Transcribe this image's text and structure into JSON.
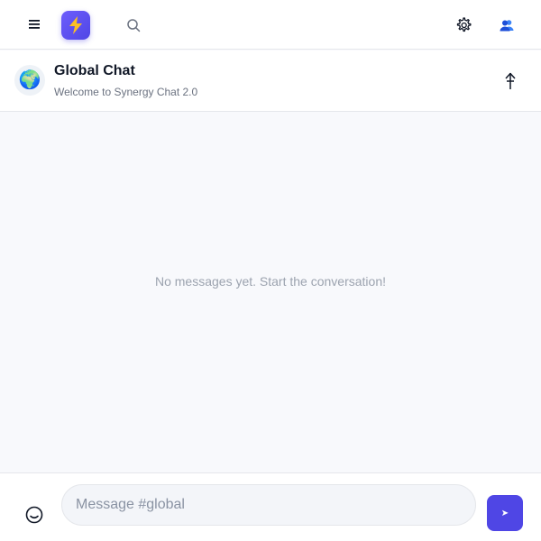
{
  "topbar": {
    "menu_icon": "hamburger-menu-icon",
    "logo_icon": "lightning-bolt-icon",
    "search_icon": "search-icon",
    "settings_icon": "gear-icon",
    "user_icon": "users-icon"
  },
  "channel": {
    "avatar_emoji": "🌍",
    "title": "Global Chat",
    "subtitle": "Welcome to Synergy Chat 2.0",
    "pin_icon": "pin-icon"
  },
  "messages": {
    "empty_text": "No messages yet. Start the conversation!"
  },
  "composer": {
    "emoji_icon": "smiley-icon",
    "placeholder": "Message #global",
    "value": "",
    "send_icon": "send-icon",
    "send_glyph": "➤"
  },
  "colors": {
    "accent": "#4f46e5",
    "background": "#f8f9fc",
    "surface": "#ffffff",
    "border": "#e5e7eb",
    "muted_text": "#9ca3af"
  }
}
